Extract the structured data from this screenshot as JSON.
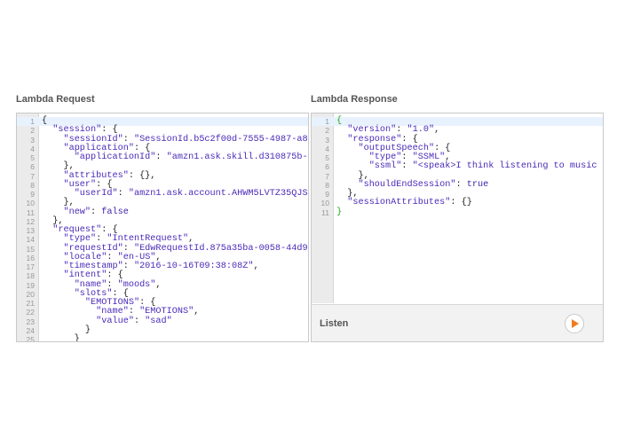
{
  "request_panel": {
    "title": "Lambda Request",
    "lines": [
      {
        "n": "1",
        "t": "{"
      },
      {
        "n": "2",
        "t": "  \"session\": {"
      },
      {
        "n": "3",
        "t": "    \"sessionId\": \"SessionId.b5c2f00d-7555-4987-a8"
      },
      {
        "n": "4",
        "t": "    \"application\": {"
      },
      {
        "n": "5",
        "t": "      \"applicationId\": \"amzn1.ask.skill.d310875b-"
      },
      {
        "n": "6",
        "t": "    },"
      },
      {
        "n": "7",
        "t": "    \"attributes\": {},"
      },
      {
        "n": "8",
        "t": "    \"user\": {"
      },
      {
        "n": "9",
        "t": "      \"userId\": \"amzn1.ask.account.AHWM5LVTZ35QJS"
      },
      {
        "n": "10",
        "t": "    },"
      },
      {
        "n": "11",
        "t": "    \"new\": false"
      },
      {
        "n": "12",
        "t": "  },"
      },
      {
        "n": "13",
        "t": "  \"request\": {"
      },
      {
        "n": "14",
        "t": "    \"type\": \"IntentRequest\","
      },
      {
        "n": "15",
        "t": "    \"requestId\": \"EdwRequestId.875a35ba-0058-44d9"
      },
      {
        "n": "16",
        "t": "    \"locale\": \"en-US\","
      },
      {
        "n": "17",
        "t": "    \"timestamp\": \"2016-10-16T09:38:08Z\","
      },
      {
        "n": "18",
        "t": "    \"intent\": {"
      },
      {
        "n": "19",
        "t": "      \"name\": \"moods\","
      },
      {
        "n": "20",
        "t": "      \"slots\": {"
      },
      {
        "n": "21",
        "t": "        \"EMOTIONS\": {"
      },
      {
        "n": "22",
        "t": "          \"name\": \"EMOTIONS\","
      },
      {
        "n": "23",
        "t": "          \"value\": \"sad\""
      },
      {
        "n": "24",
        "t": "        }"
      },
      {
        "n": "25",
        "t": "      }"
      }
    ]
  },
  "response_panel": {
    "title": "Lambda Response",
    "lines": [
      {
        "n": "1",
        "t": "{"
      },
      {
        "n": "2",
        "t": "  \"version\": \"1.0\","
      },
      {
        "n": "3",
        "t": "  \"response\": {"
      },
      {
        "n": "4",
        "t": "    \"outputSpeech\": {"
      },
      {
        "n": "5",
        "t": "      \"type\": \"SSML\","
      },
      {
        "n": "6",
        "t": "      \"ssml\": \"<speak>I think listening to music"
      },
      {
        "n": "7",
        "t": "    },"
      },
      {
        "n": "8",
        "t": "    \"shouldEndSession\": true"
      },
      {
        "n": "9",
        "t": "  },"
      },
      {
        "n": "10",
        "t": "  \"sessionAttributes\": {}"
      },
      {
        "n": "11",
        "t": "}"
      }
    ],
    "listen_label": "Listen"
  },
  "colors": {
    "string": "#4a2ab8",
    "bracket_match": "#22aa22",
    "gutter": "#ebebeb",
    "active_line": "#e8f2fe",
    "play_icon": "#f07c1f"
  },
  "icons": {
    "play": "play-icon"
  }
}
